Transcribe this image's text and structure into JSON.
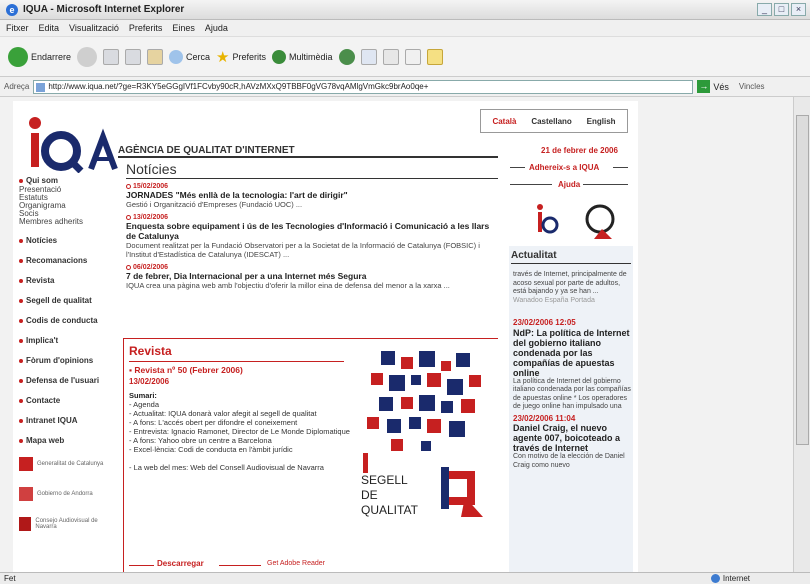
{
  "window": {
    "title": "IQUA - Microsoft Internet Explorer"
  },
  "menu": [
    "Fitxer",
    "Edita",
    "Visualització",
    "Preferits",
    "Eines",
    "Ajuda"
  ],
  "toolbar": {
    "back": "Endarrere",
    "search": "Cerca",
    "favorites": "Preferits",
    "media": "Multimèdia"
  },
  "address": {
    "label": "Adreça",
    "url": "http://www.iqua.net/?ge=R3KY5eGGgIVf1FCvby90cR,hAVzMXxQ9TBBF0gVG78vqAMlgVmGkc9brAo0qe+",
    "go": "Vés",
    "links": "Vincles"
  },
  "status": {
    "left": "Fet",
    "zone": "Internet"
  },
  "site": {
    "logo": "IQUA",
    "agency": "AGÈNCIA DE QUALITAT D'INTERNET",
    "langs": [
      "Català",
      "Castellano",
      "English"
    ],
    "date": "21 de febrer de 2006",
    "adhereix": "Adhereix-s a IQUA",
    "ajuda": "Ajuda"
  },
  "nav": {
    "quisom": "Qui som",
    "subs": [
      "Presentació",
      "Estatuts",
      "Organigrama",
      "Socis",
      "Membres adherits"
    ],
    "items": [
      "Notícies",
      "Recomanacions",
      "Revista",
      "Segell de qualitat",
      "Codis de conducta",
      "Implica't",
      "Fòrum d'opinions",
      "Defensa de l'usuari",
      "Contacte",
      "Intranet IQUA",
      "Mapa web"
    ],
    "logos": [
      "Generalitat de Catalunya",
      "Gobierno de Andorra",
      "Consejo Audiovisual de Navarra"
    ]
  },
  "news": {
    "title": "Notícies",
    "items": [
      {
        "date": "15/02/2006",
        "head": "JORNADES \"Més enllà de la tecnologia: l'art de dirigir\"",
        "body": "Gestió i Organització d'Empreses (Fundació UOC) ..."
      },
      {
        "date": "13/02/2006",
        "head": "Enquesta sobre equipament i ús de les Tecnologies d'Informació i Comunicació a les llars de Catalunya",
        "body": "Document realitzat per la Fundació Observatori per a la Societat de la Informació de Catalunya (FOBSIC) i l'Institut d'Estadística de Catalunya (IDESCAT) ..."
      },
      {
        "date": "06/02/2006",
        "head": "7 de febrer, Dia Internacional per a una Internet més Segura",
        "body": "IQUA crea una pàgina web amb l'objectiu d'oferir la millor eina de defensa del menor a la xarxa ..."
      }
    ]
  },
  "revista": {
    "title": "Revista",
    "issue": "Revista nº 50 (Febrer 2006)",
    "date": "13/02/2006",
    "sumari_label": "Sumari:",
    "sumari": [
      "- Agenda",
      "- Actualitat: IQUA donarà valor afegit al segell de qualitat",
      "- A fons: L'accés obert per difondre el coneixement",
      "- Entrevista: Ignacio Ramonet, Director de Le Monde Diplomatique",
      "- A fons: Yahoo obre un centre a Barcelona",
      "- Excel·lència: Codi de conducta en l'àmbit jurídic",
      "",
      "- La web del mes: Web del Consell Audiovisual de Navarra"
    ],
    "segell": [
      "SEGELL",
      "DE",
      "QUALITAT"
    ],
    "download": "Descarregar",
    "adobe": "Get Adobe Reader"
  },
  "actualitat": {
    "title": "Actualitat",
    "intro": "través de Internet, principalmente de acoso sexual por parte de adultos, está bajando y ya se han ...",
    "intro_src": "Wanadoo España Portada",
    "items": [
      {
        "date": "23/02/2006 12:05",
        "head": "NdP: La política de Internet del gobierno italiano condenada por las compañías de apuestas online",
        "body": "La política de Internet del gobierno italiano condenada por las compañías de apuestas online * Los operadores de juego online han impulsado una"
      },
      {
        "date": "23/02/2006 11:04",
        "head": "Daniel Craig, el nuevo agente 007, boicoteado a través de Internet",
        "body": "Con motivo de la elección de Daniel Craig como nuevo"
      }
    ]
  },
  "colors": {
    "brand_red": "#c62020",
    "dark": "#333333"
  }
}
